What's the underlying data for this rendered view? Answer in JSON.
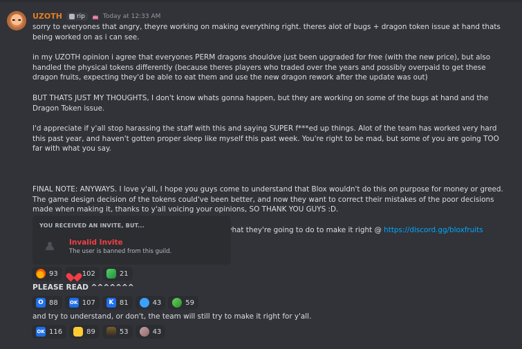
{
  "message": {
    "author": "UZOTH",
    "tag": "rip",
    "timestamp": "Today at 12:33 AM",
    "paragraphs": [
      "sorry to everyones that angry, theyre working on making everything right. theres alot of bugs + dragon token issue at hand thats being worked on as i can see.",
      "in my UZOTH opinion i agree that everyones PERM dragons shouldve just been upgraded for free (with the new price), but also handled the physical tokens differently (because theres players who traded over the years and possibly overpaid to get these dragon fruits, expecting they'd be able to eat them and use the new dragon rework after the update was out)",
      "BUT THATS JUST MY THOUGHTS, I don't know whats gonna happen, but they are working on some of the bugs at hand and the Dragon Token issue.",
      "I'd appreciate if y'all stop harassing the staff with this and saying SUPER f***ed up things. Alot of the team has worked very hard this past year, and haven't gotten proper sleep like myself this past week. You're right to be mad, but some of you are going TOO far with what you say.",
      "FINAL NOTE: ANYWAYS. I love y'all, I hope you guys come to understand that Blox wouldn't do this on purpose for money or greed. The game design decision of the tokens could've been better, and now they want to correct their mistakes of the poor decisions made when making it, thanks to y'all voicing your opinions, SO THANK YOU GUYS :D."
    ],
    "discord_line_prefix": "They'll announce in the discord when theres news on what they're going to do to make it right @ ",
    "discord_link": "https://discord.gg/bloxfruits"
  },
  "invite": {
    "title": "YOU RECEIVED AN INVITE, BUT...",
    "status": "Invalid Invite",
    "subtitle": "The user is banned from this guild."
  },
  "reactions_1": [
    {
      "icon": "fire-icon",
      "count": "93"
    },
    {
      "icon": "heart-icon",
      "count": "102"
    },
    {
      "icon": "dragon-icon",
      "count": "21"
    }
  ],
  "please_read": "PLEASE READ ^^^^^^^",
  "reactions_2": [
    {
      "icon": "o-icon",
      "count": "88",
      "label": "O"
    },
    {
      "icon": "ok-icon",
      "count": "107",
      "label": "OK"
    },
    {
      "icon": "k-icon",
      "count": "81",
      "label": "K"
    },
    {
      "icon": "ghost-icon",
      "count": "43"
    },
    {
      "icon": "plant-icon",
      "count": "59"
    }
  ],
  "final_line": "and try to understand, or don't, the team will still try to make it right for y'all.",
  "reactions_3": [
    {
      "icon": "ok-icon",
      "count": "116",
      "label": "OK"
    },
    {
      "icon": "thumbs-up-icon",
      "count": "89"
    },
    {
      "icon": "bottle-icon",
      "count": "53"
    },
    {
      "icon": "crab-icon",
      "count": "43"
    }
  ],
  "colors": {
    "background": "#313338",
    "text": "#dbdee1",
    "username": "#e67e22",
    "link": "#00a8fc",
    "danger": "#f23f43",
    "panel": "#2b2d31"
  }
}
